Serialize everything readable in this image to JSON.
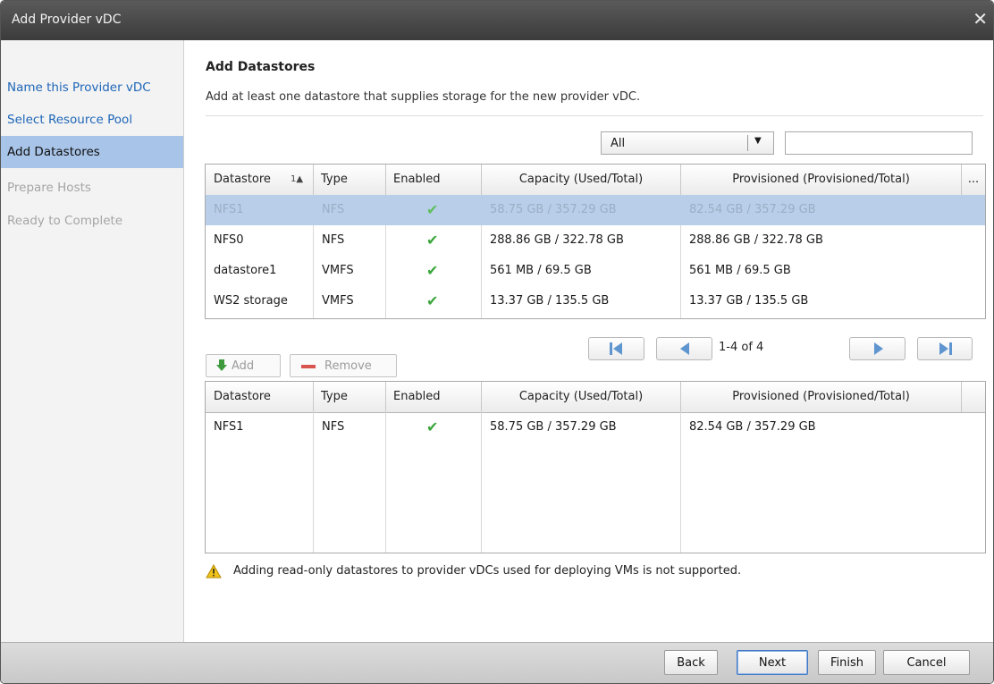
{
  "window": {
    "title": "Add Provider vDC",
    "close_glyph": "✕"
  },
  "steps": [
    {
      "label": "Name this Provider vDC",
      "state": "link"
    },
    {
      "label": "Select Resource Pool",
      "state": "link"
    },
    {
      "label": "Add Datastores",
      "state": "active"
    },
    {
      "label": "Prepare Hosts",
      "state": "disabled"
    },
    {
      "label": "Ready to Complete",
      "state": "disabled"
    }
  ],
  "page": {
    "heading": "Add Datastores",
    "description": "Add at least one datastore that supplies storage for the new provider vDC."
  },
  "filter": {
    "selected": "All",
    "arrow": "▼",
    "search_value": ""
  },
  "available_table": {
    "columns": [
      {
        "label": "Datastore",
        "sort_indicator": "1▲"
      },
      {
        "label": "Type"
      },
      {
        "label": "Enabled"
      },
      {
        "label": "Capacity (Used/Total)"
      },
      {
        "label": "Provisioned (Provisioned/Total)"
      },
      {
        "label": "..."
      }
    ],
    "rows": [
      {
        "name": "NFS1",
        "type": "NFS",
        "enabled": "✔",
        "capacity": "58.75 GB / 357.29 GB",
        "provisioned": "82.54 GB / 357.29 GB",
        "selected": true
      },
      {
        "name": "NFS0",
        "type": "NFS",
        "enabled": "✔",
        "capacity": "288.86 GB / 322.78 GB",
        "provisioned": "288.86 GB / 322.78 GB",
        "selected": false
      },
      {
        "name": "datastore1",
        "type": "VMFS",
        "enabled": "✔",
        "capacity": "561 MB / 69.5 GB",
        "provisioned": "561 MB / 69.5 GB",
        "selected": false
      },
      {
        "name": "WS2 storage",
        "type": "VMFS",
        "enabled": "✔",
        "capacity": "13.37 GB / 135.5 GB",
        "provisioned": "13.37 GB / 135.5 GB",
        "selected": false
      }
    ]
  },
  "pagination": {
    "info": "1-4 of 4"
  },
  "actions": {
    "add_label": "Add",
    "remove_label": "Remove"
  },
  "selected_table": {
    "columns": [
      {
        "label": "Datastore"
      },
      {
        "label": "Type"
      },
      {
        "label": "Enabled"
      },
      {
        "label": "Capacity (Used/Total)"
      },
      {
        "label": "Provisioned (Provisioned/Total)"
      }
    ],
    "rows": [
      {
        "name": "NFS1",
        "type": "NFS",
        "enabled": "✔",
        "capacity": "58.75 GB / 357.29 GB",
        "provisioned": "82.54 GB / 357.29 GB"
      }
    ]
  },
  "warning": {
    "text": "Adding read-only datastores to provider vDCs used for deploying VMs is not supported."
  },
  "footer": {
    "back": "Back",
    "next": "Next",
    "finish": "Finish",
    "cancel": "Cancel"
  },
  "colors": {
    "selected_step": "#a8c4e8",
    "selected_row": "#b9cfe9",
    "link": "#1e66b8",
    "check": "#3aa63a",
    "warning": "#f0c419"
  }
}
